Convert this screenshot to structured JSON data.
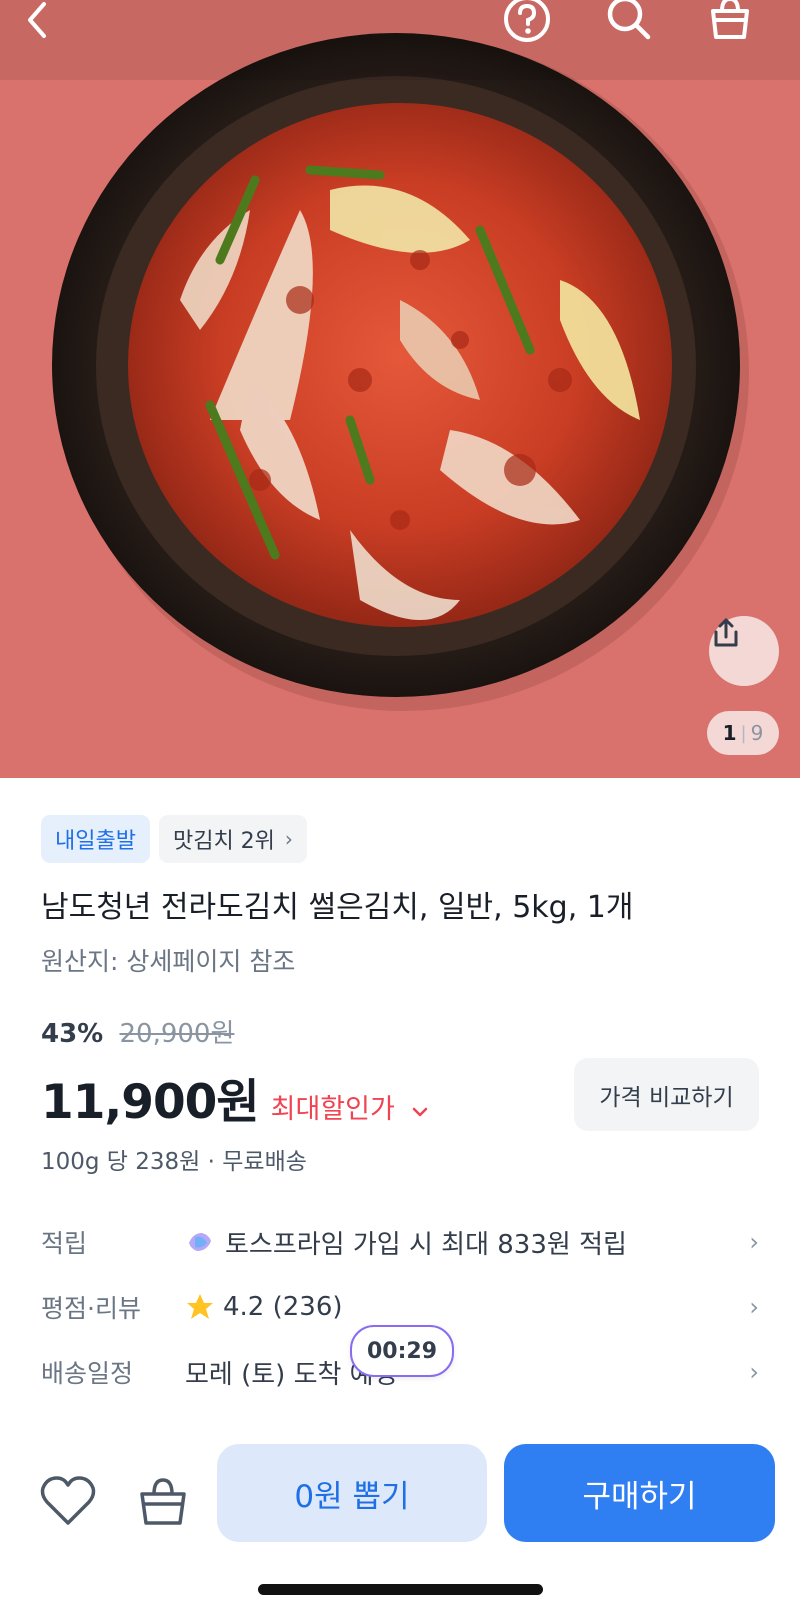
{
  "header": {
    "back_icon": "chevron-left-icon",
    "help_icon": "question-circle-icon",
    "search_icon": "search-icon",
    "cart_icon": "shopping-bag-icon"
  },
  "gallery": {
    "current": "1",
    "separator": "|",
    "total": "9",
    "share_icon": "share-icon"
  },
  "badges": {
    "shipping": "내일출발",
    "ranking": "맛김치 2위",
    "ranking_chevron": "›"
  },
  "product": {
    "title": "남도청년 전라도김치 썰은김치, 일반, 5kg, 1개",
    "origin": "원산지: 상세페이지 참조",
    "discount_percent": "43%",
    "original_price": "20,900원",
    "price": "11,900원",
    "max_discount_label": "최대할인가",
    "compare_button": "가격 비교하기",
    "unit_info": "100g 당 238원 · 무료배송"
  },
  "info_rows": {
    "reward": {
      "label": "적립",
      "value": "토스프라임 가입 시 최대 833원 적립"
    },
    "rating": {
      "label": "평점·리뷰",
      "value": "4.2 (236)"
    },
    "delivery": {
      "label": "배송일정",
      "value": "모레 (토) 도착 예정"
    },
    "arrow": "›"
  },
  "timer": "00:29",
  "bottom_bar": {
    "draw_button": "0원 뽑기",
    "buy_button": "구매하기"
  },
  "colors": {
    "accent": "#2f7ef2",
    "discount_red": "#f04452",
    "badge_blue_text": "#1f6fe6"
  }
}
